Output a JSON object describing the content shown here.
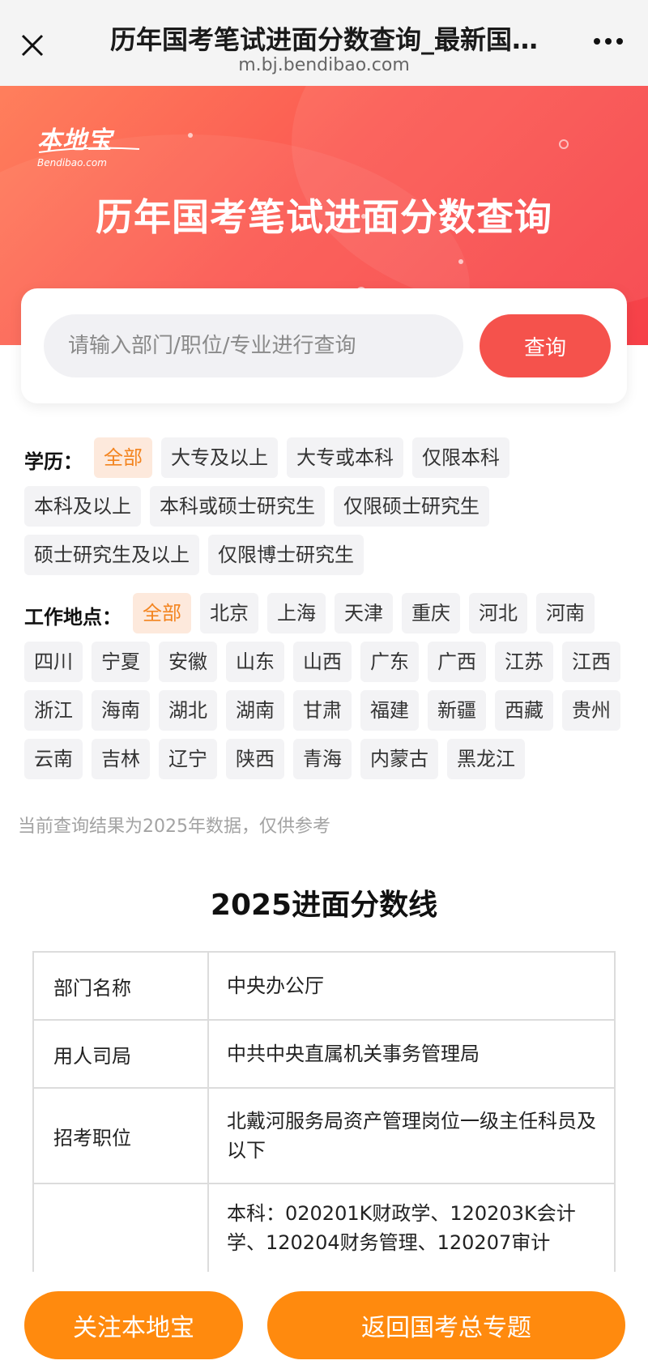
{
  "browser": {
    "title": "历年国考笔试进面分数查询_最新国…",
    "url": "m.bj.bendibao.com",
    "close_icon": "close-icon",
    "more_icon": "more-dots-icon"
  },
  "banner": {
    "logo_text": "本地宝",
    "logo_sub": "Bendibao.com",
    "title": "历年国考笔试进面分数查询"
  },
  "search": {
    "placeholder": "请输入部门/职位/专业进行查询",
    "button_label": "查询"
  },
  "filters": {
    "education": {
      "label": "学历：",
      "options": [
        "全部",
        "大专及以上",
        "大专或本科",
        "仅限本科",
        "本科及以上",
        "本科或硕士研究生",
        "仅限硕士研究生",
        "硕士研究生及以上",
        "仅限博士研究生"
      ],
      "selected": "全部"
    },
    "location": {
      "label": "工作地点：",
      "options": [
        "全部",
        "北京",
        "上海",
        "天津",
        "重庆",
        "河北",
        "河南",
        "四川",
        "宁夏",
        "安徽",
        "山东",
        "山西",
        "广东",
        "广西",
        "江苏",
        "江西",
        "浙江",
        "海南",
        "湖北",
        "湖南",
        "甘肃",
        "福建",
        "新疆",
        "西藏",
        "贵州",
        "云南",
        "吉林",
        "辽宁",
        "陕西",
        "青海",
        "内蒙古",
        "黑龙江"
      ],
      "selected": "全部"
    }
  },
  "note": "当前查询结果为2025年数据，仅供参考",
  "result": {
    "title": "2025进面分数线",
    "rows": [
      {
        "key": "部门名称",
        "value": "中央办公厅"
      },
      {
        "key": "用人司局",
        "value": "中共中央直属机关事务管理局"
      },
      {
        "key": "招考职位",
        "value": "北戴河服务局资产管理岗位一级主任科员及以下"
      },
      {
        "key": "",
        "value": "本科：020201K财政学、120203K会计学、120204财务管理、120207审计"
      }
    ]
  },
  "bottom": {
    "follow_label": "关注本地宝",
    "return_label": "返回国考总专题"
  }
}
